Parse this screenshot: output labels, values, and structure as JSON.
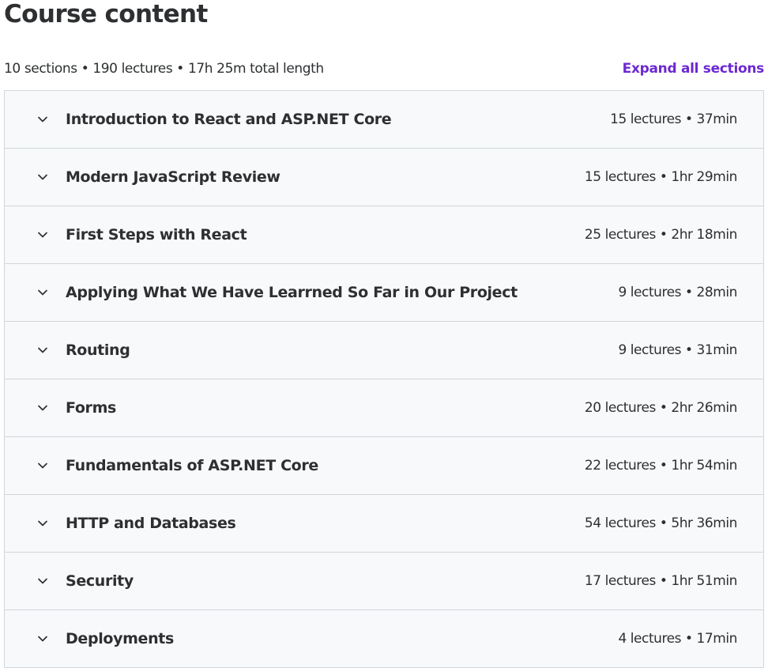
{
  "header": {
    "title": "Course content",
    "summary": "10 sections • 190 lectures • 17h 25m total length",
    "expand_label": "Expand all sections"
  },
  "colors": {
    "accent": "#6d28d2",
    "text": "#2d2f31",
    "section_bg": "#f7f9fa",
    "border": "#d1d7dc"
  },
  "sections": [
    {
      "title": "Introduction to React and ASP.NET Core",
      "info": "15 lectures • 37min",
      "icon": "chevron-down-icon"
    },
    {
      "title": "Modern JavaScript Review",
      "info": "15 lectures • 1hr 29min",
      "icon": "chevron-down-icon"
    },
    {
      "title": "First Steps with React",
      "info": "25 lectures • 2hr 18min",
      "icon": "chevron-down-icon"
    },
    {
      "title": "Applying What We Have Learrned So Far in Our Project",
      "info": "9 lectures • 28min",
      "icon": "chevron-down-icon"
    },
    {
      "title": "Routing",
      "info": "9 lectures • 31min",
      "icon": "chevron-down-icon"
    },
    {
      "title": "Forms",
      "info": "20 lectures • 2hr 26min",
      "icon": "chevron-down-icon"
    },
    {
      "title": "Fundamentals of ASP.NET Core",
      "info": "22 lectures • 1hr 54min",
      "icon": "chevron-down-icon"
    },
    {
      "title": "HTTP and Databases",
      "info": "54 lectures • 5hr 36min",
      "icon": "chevron-down-icon"
    },
    {
      "title": "Security",
      "info": "17 lectures • 1hr 51min",
      "icon": "chevron-down-icon"
    },
    {
      "title": "Deployments",
      "info": "4 lectures • 17min",
      "icon": "chevron-down-icon"
    }
  ]
}
